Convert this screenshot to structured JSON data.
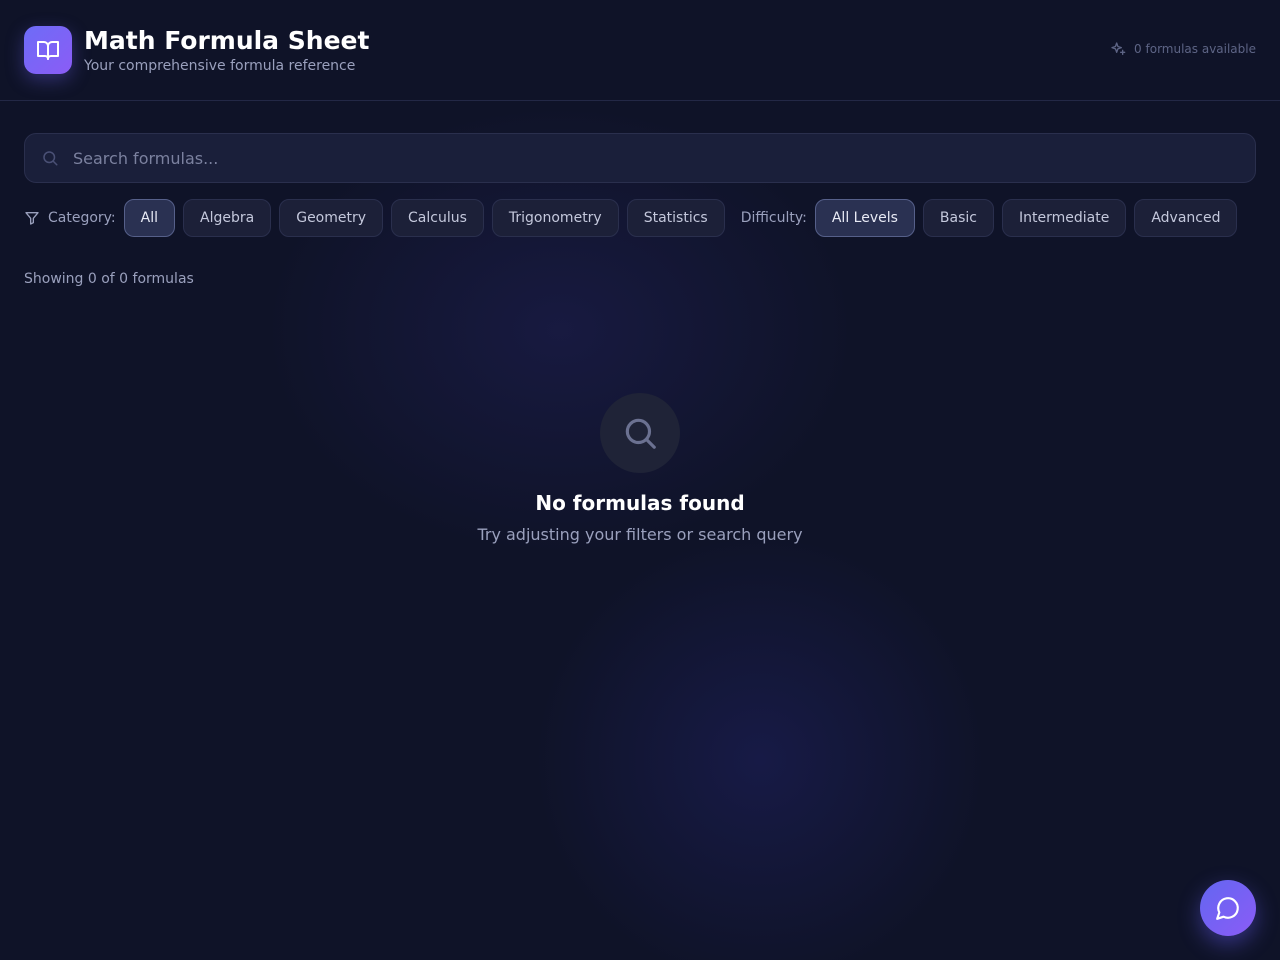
{
  "header": {
    "title": "Math Formula Sheet",
    "subtitle": "Your comprehensive formula reference",
    "count_text": "0 formulas available",
    "logo_icon": "book-open-icon",
    "count_icon": "sparkles-icon"
  },
  "search": {
    "placeholder": "Search formulas...",
    "value": ""
  },
  "filters": {
    "category_label": "Category:",
    "categories": [
      "All",
      "Algebra",
      "Geometry",
      "Calculus",
      "Trigonometry",
      "Statistics"
    ],
    "category_selected": "All",
    "difficulty_label": "Difficulty:",
    "difficulties": [
      "All Levels",
      "Basic",
      "Intermediate",
      "Advanced"
    ],
    "difficulty_selected": "All Levels"
  },
  "results": {
    "showing_text": "Showing 0 of 0 formulas"
  },
  "empty_state": {
    "title": "No formulas found",
    "subtitle": "Try adjusting your filters or search query"
  },
  "colors": {
    "background": "#0f1328",
    "accent": "#6d6cf7",
    "accent_secondary": "#8b5cf6"
  }
}
